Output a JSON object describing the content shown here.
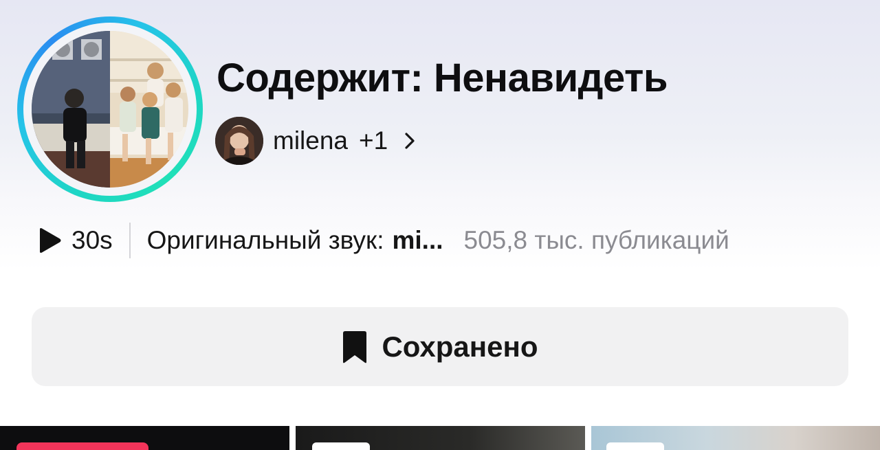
{
  "sound": {
    "title": "Содержит: Ненавидеть",
    "author": {
      "name": "milena",
      "extra_count": "+1"
    },
    "duration": "30s",
    "sound_label": "Оригинальный звук:",
    "sound_author_truncated": "mi...",
    "posts_count": "505,8 тыс. публикаций"
  },
  "actions": {
    "save_label": "Сохранено",
    "save_icon": "bookmark-filled-icon"
  },
  "icons": {
    "play": "play-icon",
    "chevron": "chevron-right-icon"
  },
  "colors": {
    "ring_start": "#1ed6c4",
    "ring_end": "#2a8df0",
    "badge_red": "#f2345a",
    "muted_text": "#8b8b91"
  }
}
